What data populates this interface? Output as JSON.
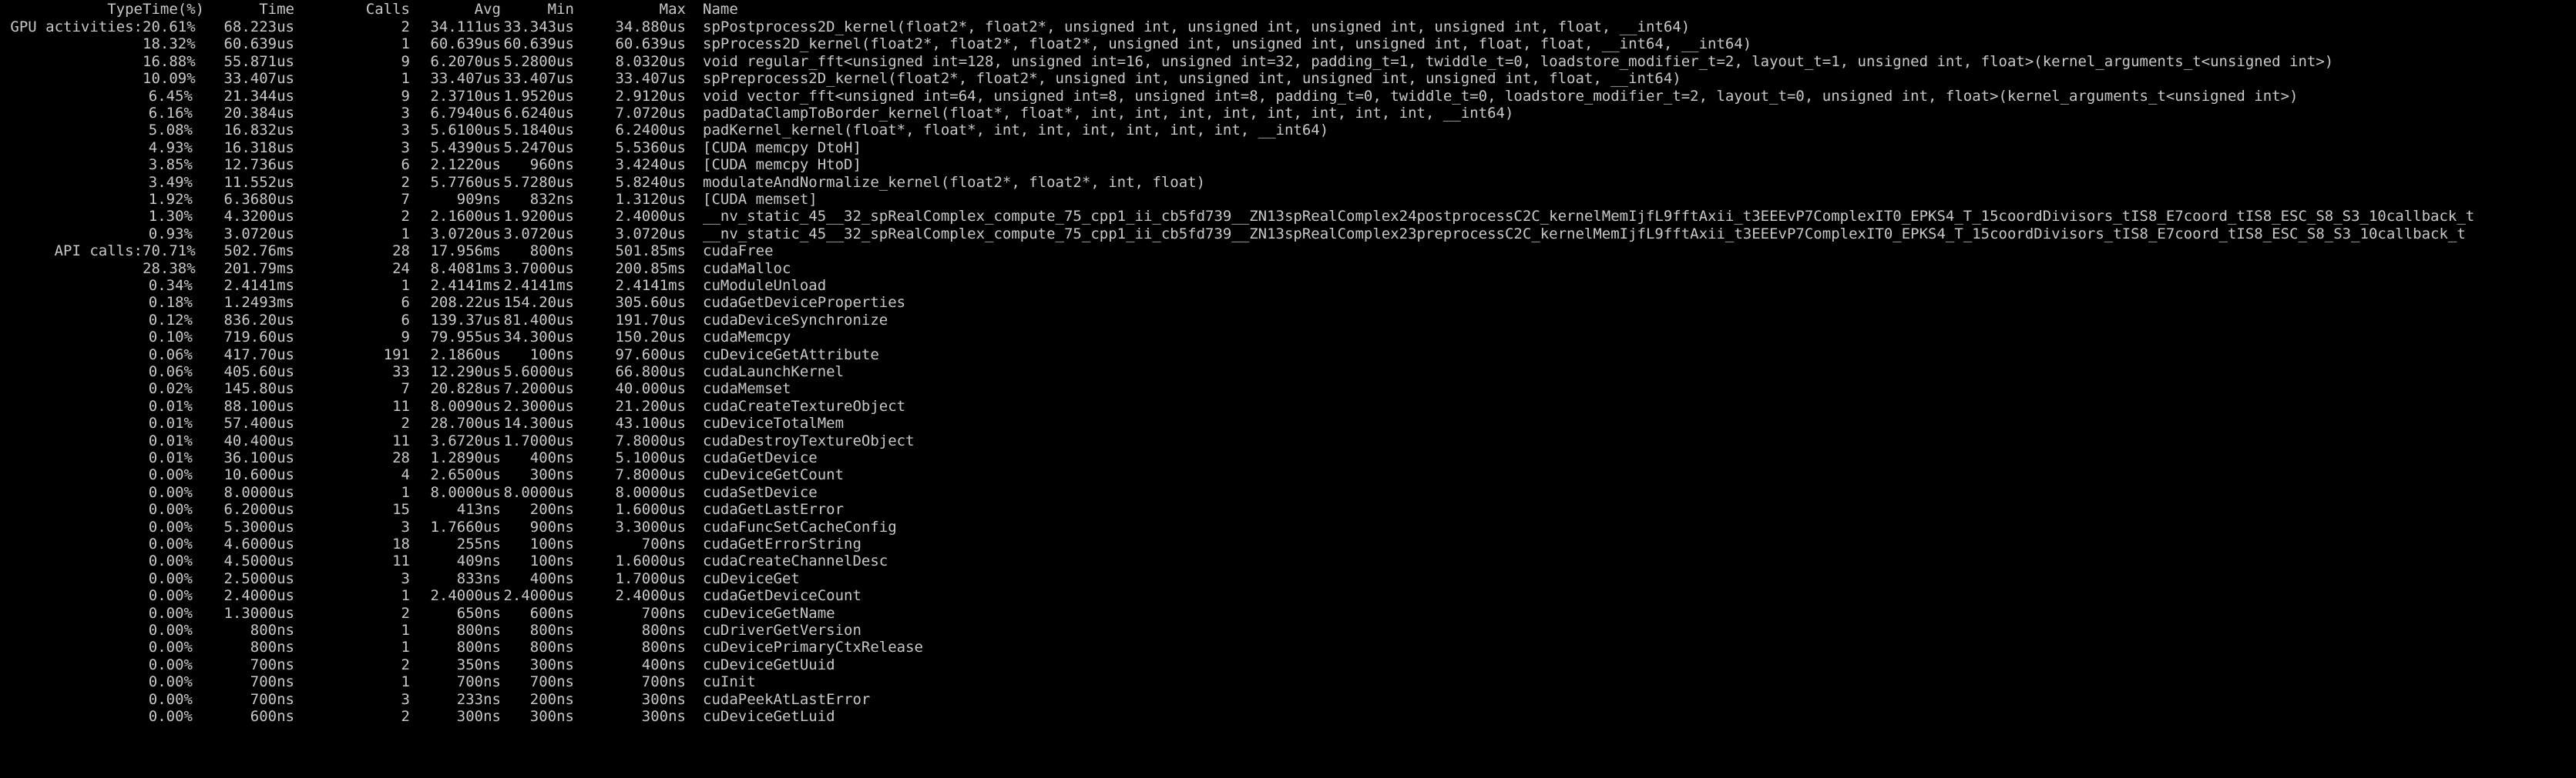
{
  "header": {
    "type": "Type",
    "time_pct": "Time(%)",
    "time": "Time",
    "calls": "Calls",
    "avg": "Avg",
    "min": "Min",
    "max": "Max",
    "name": "Name"
  },
  "rows": [
    {
      "type": "GPU activities:",
      "time_pct": "20.61%",
      "time": "68.223us",
      "calls": "2",
      "avg": "34.111us",
      "min": "33.343us",
      "max": "34.880us",
      "name": "spPostprocess2D_kernel(float2*, float2*, unsigned int, unsigned int, unsigned int, unsigned int, float, __int64)"
    },
    {
      "type": "",
      "time_pct": "18.32%",
      "time": "60.639us",
      "calls": "1",
      "avg": "60.639us",
      "min": "60.639us",
      "max": "60.639us",
      "name": "spProcess2D_kernel(float2*, float2*, float2*, unsigned int, unsigned int, unsigned int, float, float, __int64, __int64)"
    },
    {
      "type": "",
      "time_pct": "16.88%",
      "time": "55.871us",
      "calls": "9",
      "avg": "6.2070us",
      "min": "5.2800us",
      "max": "8.0320us",
      "name": "void regular_fft<unsigned int=128, unsigned int=16, unsigned int=32, padding_t=1, twiddle_t=0, loadstore_modifier_t=2, layout_t=1, unsigned int, float>(kernel_arguments_t<unsigned int>)"
    },
    {
      "type": "",
      "time_pct": "10.09%",
      "time": "33.407us",
      "calls": "1",
      "avg": "33.407us",
      "min": "33.407us",
      "max": "33.407us",
      "name": "spPreprocess2D_kernel(float2*, float2*, unsigned int, unsigned int, unsigned int, unsigned int, float, __int64)"
    },
    {
      "type": "",
      "time_pct": "6.45%",
      "time": "21.344us",
      "calls": "9",
      "avg": "2.3710us",
      "min": "1.9520us",
      "max": "2.9120us",
      "name": "void vector_fft<unsigned int=64, unsigned int=8, unsigned int=8, padding_t=0, twiddle_t=0, loadstore_modifier_t=2, layout_t=0, unsigned int, float>(kernel_arguments_t<unsigned int>)"
    },
    {
      "type": "",
      "time_pct": "6.16%",
      "time": "20.384us",
      "calls": "3",
      "avg": "6.7940us",
      "min": "6.6240us",
      "max": "7.0720us",
      "name": "padDataClampToBorder_kernel(float*, float*, int, int, int, int, int, int, int, int, __int64)"
    },
    {
      "type": "",
      "time_pct": "5.08%",
      "time": "16.832us",
      "calls": "3",
      "avg": "5.6100us",
      "min": "5.1840us",
      "max": "6.2400us",
      "name": "padKernel_kernel(float*, float*, int, int, int, int, int, int, __int64)"
    },
    {
      "type": "",
      "time_pct": "4.93%",
      "time": "16.318us",
      "calls": "3",
      "avg": "5.4390us",
      "min": "5.2470us",
      "max": "5.5360us",
      "name": "[CUDA memcpy DtoH]"
    },
    {
      "type": "",
      "time_pct": "3.85%",
      "time": "12.736us",
      "calls": "6",
      "avg": "2.1220us",
      "min": "960ns",
      "max": "3.4240us",
      "name": "[CUDA memcpy HtoD]"
    },
    {
      "type": "",
      "time_pct": "3.49%",
      "time": "11.552us",
      "calls": "2",
      "avg": "5.7760us",
      "min": "5.7280us",
      "max": "5.8240us",
      "name": "modulateAndNormalize_kernel(float2*, float2*, int, float)"
    },
    {
      "type": "",
      "time_pct": "1.92%",
      "time": "6.3680us",
      "calls": "7",
      "avg": "909ns",
      "min": "832ns",
      "max": "1.3120us",
      "name": "[CUDA memset]"
    },
    {
      "type": "",
      "time_pct": "1.30%",
      "time": "4.3200us",
      "calls": "2",
      "avg": "2.1600us",
      "min": "1.9200us",
      "max": "2.4000us",
      "name": "__nv_static_45__32_spRealComplex_compute_75_cpp1_ii_cb5fd739__ZN13spRealComplex24postprocessC2C_kernelMemIjfL9fftAxii_t3EEEvP7ComplexIT0_EPKS4_T_15coordDivisors_tIS8_E7coord_tIS8_ESC_S8_S3_10callback_t"
    },
    {
      "type": "",
      "time_pct": "0.93%",
      "time": "3.0720us",
      "calls": "1",
      "avg": "3.0720us",
      "min": "3.0720us",
      "max": "3.0720us",
      "name": "__nv_static_45__32_spRealComplex_compute_75_cpp1_ii_cb5fd739__ZN13spRealComplex23preprocessC2C_kernelMemIjfL9fftAxii_t3EEEvP7ComplexIT0_EPKS4_T_15coordDivisors_tIS8_E7coord_tIS8_ESC_S8_S3_10callback_t"
    },
    {
      "type": "API calls:",
      "time_pct": "70.71%",
      "time": "502.76ms",
      "calls": "28",
      "avg": "17.956ms",
      "min": "800ns",
      "max": "501.85ms",
      "name": "cudaFree"
    },
    {
      "type": "",
      "time_pct": "28.38%",
      "time": "201.79ms",
      "calls": "24",
      "avg": "8.4081ms",
      "min": "3.7000us",
      "max": "200.85ms",
      "name": "cudaMalloc"
    },
    {
      "type": "",
      "time_pct": "0.34%",
      "time": "2.4141ms",
      "calls": "1",
      "avg": "2.4141ms",
      "min": "2.4141ms",
      "max": "2.4141ms",
      "name": "cuModuleUnload"
    },
    {
      "type": "",
      "time_pct": "0.18%",
      "time": "1.2493ms",
      "calls": "6",
      "avg": "208.22us",
      "min": "154.20us",
      "max": "305.60us",
      "name": "cudaGetDeviceProperties"
    },
    {
      "type": "",
      "time_pct": "0.12%",
      "time": "836.20us",
      "calls": "6",
      "avg": "139.37us",
      "min": "81.400us",
      "max": "191.70us",
      "name": "cudaDeviceSynchronize"
    },
    {
      "type": "",
      "time_pct": "0.10%",
      "time": "719.60us",
      "calls": "9",
      "avg": "79.955us",
      "min": "34.300us",
      "max": "150.20us",
      "name": "cudaMemcpy"
    },
    {
      "type": "",
      "time_pct": "0.06%",
      "time": "417.70us",
      "calls": "191",
      "avg": "2.1860us",
      "min": "100ns",
      "max": "97.600us",
      "name": "cuDeviceGetAttribute"
    },
    {
      "type": "",
      "time_pct": "0.06%",
      "time": "405.60us",
      "calls": "33",
      "avg": "12.290us",
      "min": "5.6000us",
      "max": "66.800us",
      "name": "cudaLaunchKernel"
    },
    {
      "type": "",
      "time_pct": "0.02%",
      "time": "145.80us",
      "calls": "7",
      "avg": "20.828us",
      "min": "7.2000us",
      "max": "40.000us",
      "name": "cudaMemset"
    },
    {
      "type": "",
      "time_pct": "0.01%",
      "time": "88.100us",
      "calls": "11",
      "avg": "8.0090us",
      "min": "2.3000us",
      "max": "21.200us",
      "name": "cudaCreateTextureObject"
    },
    {
      "type": "",
      "time_pct": "0.01%",
      "time": "57.400us",
      "calls": "2",
      "avg": "28.700us",
      "min": "14.300us",
      "max": "43.100us",
      "name": "cuDeviceTotalMem"
    },
    {
      "type": "",
      "time_pct": "0.01%",
      "time": "40.400us",
      "calls": "11",
      "avg": "3.6720us",
      "min": "1.7000us",
      "max": "7.8000us",
      "name": "cudaDestroyTextureObject"
    },
    {
      "type": "",
      "time_pct": "0.01%",
      "time": "36.100us",
      "calls": "28",
      "avg": "1.2890us",
      "min": "400ns",
      "max": "5.1000us",
      "name": "cudaGetDevice"
    },
    {
      "type": "",
      "time_pct": "0.00%",
      "time": "10.600us",
      "calls": "4",
      "avg": "2.6500us",
      "min": "300ns",
      "max": "7.8000us",
      "name": "cuDeviceGetCount"
    },
    {
      "type": "",
      "time_pct": "0.00%",
      "time": "8.0000us",
      "calls": "1",
      "avg": "8.0000us",
      "min": "8.0000us",
      "max": "8.0000us",
      "name": "cudaSetDevice"
    },
    {
      "type": "",
      "time_pct": "0.00%",
      "time": "6.2000us",
      "calls": "15",
      "avg": "413ns",
      "min": "200ns",
      "max": "1.6000us",
      "name": "cudaGetLastError"
    },
    {
      "type": "",
      "time_pct": "0.00%",
      "time": "5.3000us",
      "calls": "3",
      "avg": "1.7660us",
      "min": "900ns",
      "max": "3.3000us",
      "name": "cudaFuncSetCacheConfig"
    },
    {
      "type": "",
      "time_pct": "0.00%",
      "time": "4.6000us",
      "calls": "18",
      "avg": "255ns",
      "min": "100ns",
      "max": "700ns",
      "name": "cudaGetErrorString"
    },
    {
      "type": "",
      "time_pct": "0.00%",
      "time": "4.5000us",
      "calls": "11",
      "avg": "409ns",
      "min": "100ns",
      "max": "1.6000us",
      "name": "cudaCreateChannelDesc"
    },
    {
      "type": "",
      "time_pct": "0.00%",
      "time": "2.5000us",
      "calls": "3",
      "avg": "833ns",
      "min": "400ns",
      "max": "1.7000us",
      "name": "cuDeviceGet"
    },
    {
      "type": "",
      "time_pct": "0.00%",
      "time": "2.4000us",
      "calls": "1",
      "avg": "2.4000us",
      "min": "2.4000us",
      "max": "2.4000us",
      "name": "cudaGetDeviceCount"
    },
    {
      "type": "",
      "time_pct": "0.00%",
      "time": "1.3000us",
      "calls": "2",
      "avg": "650ns",
      "min": "600ns",
      "max": "700ns",
      "name": "cuDeviceGetName"
    },
    {
      "type": "",
      "time_pct": "0.00%",
      "time": "800ns",
      "calls": "1",
      "avg": "800ns",
      "min": "800ns",
      "max": "800ns",
      "name": "cuDriverGetVersion"
    },
    {
      "type": "",
      "time_pct": "0.00%",
      "time": "800ns",
      "calls": "1",
      "avg": "800ns",
      "min": "800ns",
      "max": "800ns",
      "name": "cuDevicePrimaryCtxRelease"
    },
    {
      "type": "",
      "time_pct": "0.00%",
      "time": "700ns",
      "calls": "2",
      "avg": "350ns",
      "min": "300ns",
      "max": "400ns",
      "name": "cuDeviceGetUuid"
    },
    {
      "type": "",
      "time_pct": "0.00%",
      "time": "700ns",
      "calls": "1",
      "avg": "700ns",
      "min": "700ns",
      "max": "700ns",
      "name": "cuInit"
    },
    {
      "type": "",
      "time_pct": "0.00%",
      "time": "700ns",
      "calls": "3",
      "avg": "233ns",
      "min": "200ns",
      "max": "300ns",
      "name": "cudaPeekAtLastError"
    },
    {
      "type": "",
      "time_pct": "0.00%",
      "time": "600ns",
      "calls": "2",
      "avg": "300ns",
      "min": "300ns",
      "max": "300ns",
      "name": "cuDeviceGetLuid"
    }
  ]
}
